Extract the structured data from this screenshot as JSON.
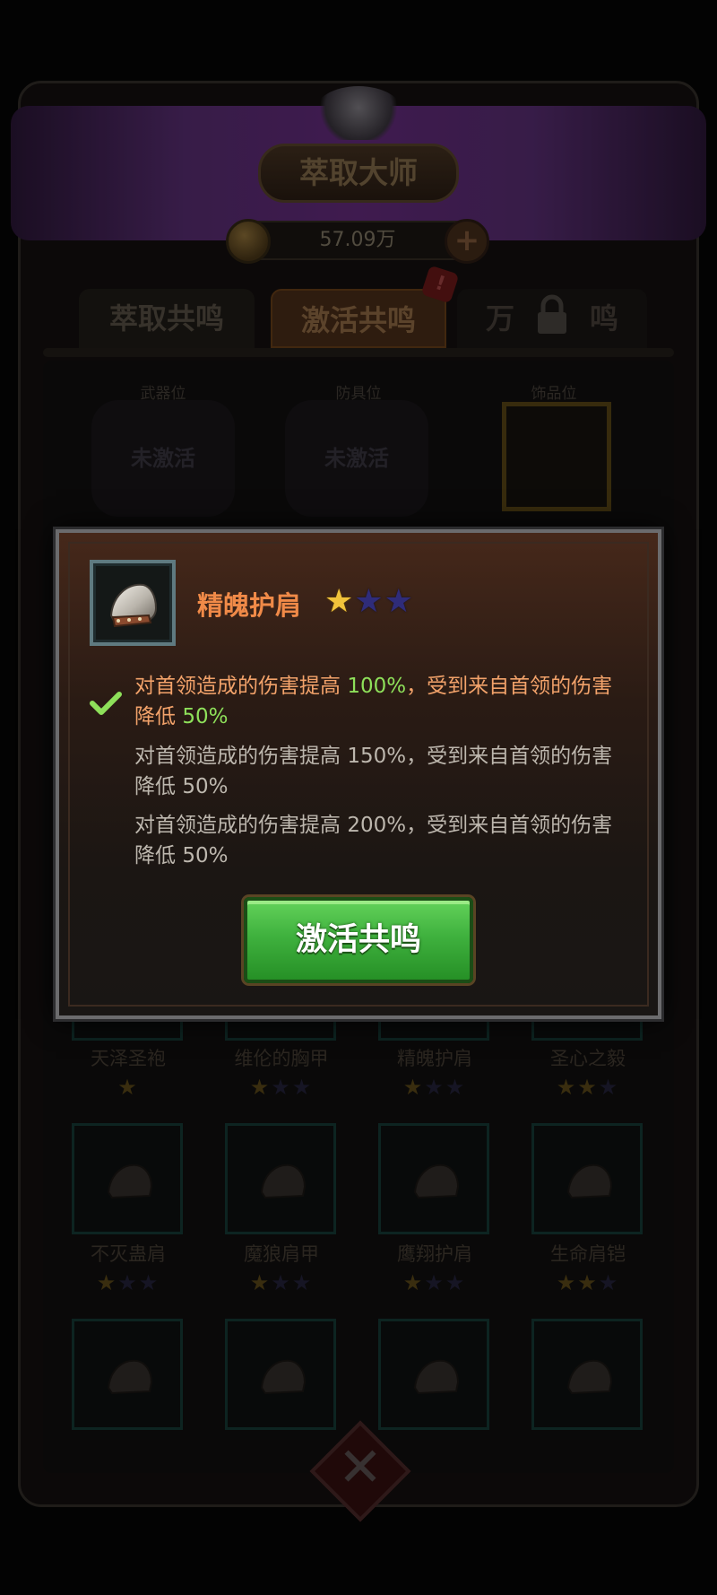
{
  "header": {
    "title": "萃取大师",
    "currency_amount": "57.09万",
    "currency_icon": "coin-icon",
    "add_icon": "plus-icon"
  },
  "tabs": [
    {
      "label": "萃取共鸣",
      "active": false
    },
    {
      "label": "激活共鸣",
      "active": true,
      "badge": "!"
    },
    {
      "label": "万能共鸣",
      "locked": true,
      "visible_text": "万",
      "visible_text_tail": "鸣"
    }
  ],
  "slots": [
    {
      "label": "武器位",
      "status": "未激活"
    },
    {
      "label": "防具位",
      "status": "未激活"
    },
    {
      "label": "饰品位",
      "status": ""
    }
  ],
  "grid_items": [
    {
      "name": "天泽圣袍",
      "stars": 1,
      "max_stars": 1
    },
    {
      "name": "维伦的胸甲",
      "stars": 1,
      "max_stars": 3
    },
    {
      "name": "精魄护肩",
      "stars": 1,
      "max_stars": 3
    },
    {
      "name": "圣心之毅",
      "stars": 2,
      "max_stars": 3
    },
    {
      "name": "不灭蛊肩",
      "stars": 1,
      "max_stars": 3
    },
    {
      "name": "魔狼肩甲",
      "stars": 1,
      "max_stars": 3
    },
    {
      "name": "鹰翔护肩",
      "stars": 1,
      "max_stars": 3
    },
    {
      "name": "生命肩铠",
      "stars": 2,
      "max_stars": 3
    },
    {
      "name": "",
      "stars": 0,
      "max_stars": 0
    },
    {
      "name": "",
      "stars": 0,
      "max_stars": 0
    },
    {
      "name": "",
      "stars": 0,
      "max_stars": 0
    },
    {
      "name": "",
      "stars": 0,
      "max_stars": 0
    }
  ],
  "modal": {
    "item_name": "精魄护肩",
    "stars_filled": 1,
    "stars_total": 3,
    "item_icon": "shoulder-armor-icon",
    "effects": [
      {
        "pre": "对首领造成的伤害提高 ",
        "value1": "100%",
        "mid": "，受到来自首领的伤害降低 ",
        "value2": "50%",
        "active": true
      },
      {
        "pre": "对首领造成的伤害提高 ",
        "value1": "150%",
        "mid": "，受到来自首领的伤害降低 ",
        "value2": "50%",
        "active": false
      },
      {
        "pre": "对首领造成的伤害提高 ",
        "value1": "200%",
        "mid": "，受到来自首领的伤害降低 ",
        "value2": "50%",
        "active": false
      }
    ],
    "activate_label": "激活共鸣"
  },
  "colors": {
    "title_orange": "#f08a48",
    "highlight_green": "#8ee05a",
    "button_green": "#3fb13e",
    "star_gold": "#f1c33b",
    "star_empty": "#2f2c7a"
  }
}
